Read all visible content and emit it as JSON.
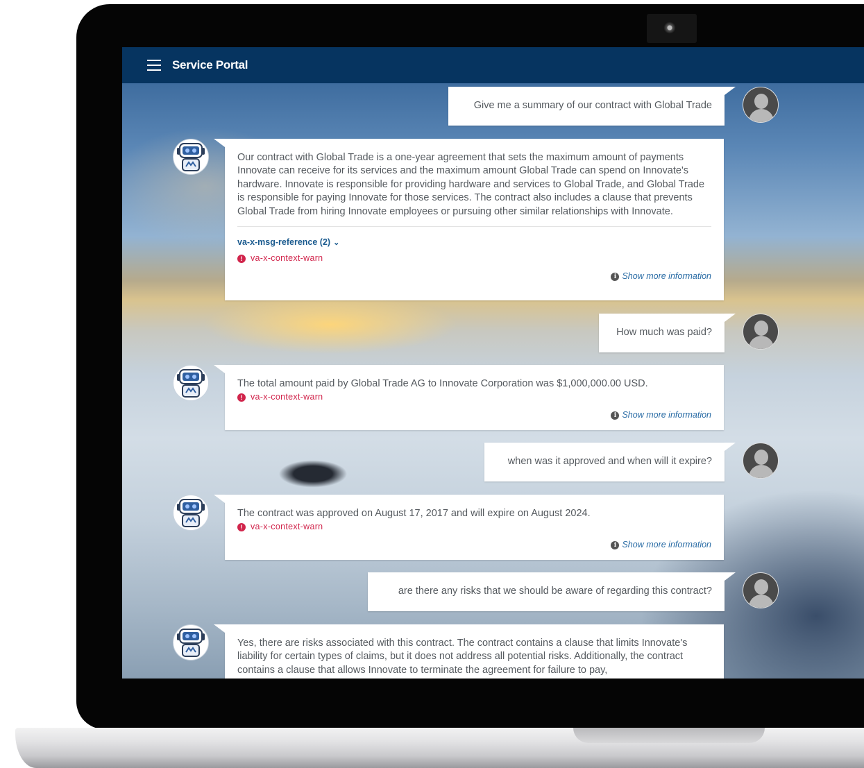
{
  "header": {
    "title": "Service Portal"
  },
  "conversation": [
    {
      "role": "user",
      "text": "Give me a summary of our contract with Global Trade"
    },
    {
      "role": "bot",
      "text": "Our contract with Global Trade is a one-year agreement that sets the maximum amount of payments Innovate can receive for its services and the maximum amount Global Trade can spend on Innovate's hardware. Innovate is responsible for providing hardware and services to Global Trade, and Global Trade is responsible for paying Innovate for those services. The contract also includes a clause that prevents Global Trade from hiring Innovate employees or pursuing other similar relationships with Innovate.",
      "reference": "va-x-msg-reference (2)",
      "warning": "va-x-context-warn",
      "more": "Show more information"
    },
    {
      "role": "user",
      "text": "How much was paid?"
    },
    {
      "role": "bot",
      "text": "The total amount paid by Global Trade AG to Innovate Corporation was $1,000,000.00 USD.",
      "warning": "va-x-context-warn",
      "more": "Show more information"
    },
    {
      "role": "user",
      "text": "when was it approved and when will it expire?"
    },
    {
      "role": "bot",
      "text": "The contract was approved on August 17, 2017 and will expire on August 2024.",
      "warning": "va-x-context-warn",
      "more": "Show more information"
    },
    {
      "role": "user",
      "text": "are there any risks that we should be aware of regarding this contract?"
    },
    {
      "role": "bot",
      "text": "Yes, there are risks associated with this contract. The contract contains a clause that limits Innovate's liability for certain types of claims, but it does not address all potential risks. Additionally, the contract contains a clause that allows Innovate to terminate the agreement for failure to pay,"
    }
  ],
  "icons": {
    "menu": "hamburger-menu-icon",
    "user_avatar": "user-avatar-icon",
    "bot_avatar": "virtual-agent-robot-icon",
    "warning": "error-circle-icon",
    "info": "info-circle-icon",
    "expand": "chevron-down-icon"
  },
  "colors": {
    "header_bg": "#063460",
    "warning": "#d1244b",
    "link": "#2a6ca5"
  }
}
